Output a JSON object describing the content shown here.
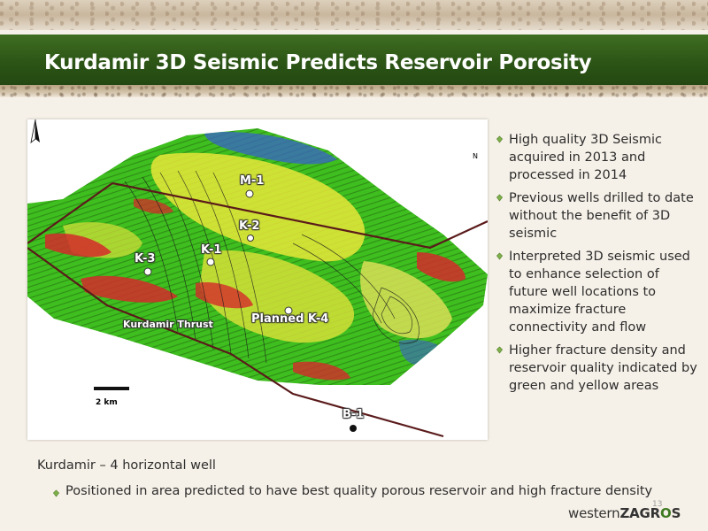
{
  "slide": {
    "title": "Kurdamir 3D Seismic Predicts Reservoir Porosity",
    "page_number": "13"
  },
  "map": {
    "north_label": "N",
    "scale_label": "2 km",
    "wells": [
      {
        "label": "M-1"
      },
      {
        "label": "K-2"
      },
      {
        "label": "K-1"
      },
      {
        "label": "K-3"
      },
      {
        "label": "Planned K-4"
      },
      {
        "label": "B-1"
      }
    ],
    "fault_label": "Kurdamir Thrust",
    "colors": {
      "green": "#3fbf1f",
      "yellow": "#e8e63a",
      "red": "#d42a2a",
      "blue": "#3a63c9"
    }
  },
  "bullets": [
    {
      "text": "High quality 3D Seismic acquired in 2013 and processed in 2014"
    },
    {
      "text": "Previous wells drilled to date without the benefit of 3D seismic"
    },
    {
      "text": "Interpreted 3D seismic used to enhance selection of future well locations to maximize fracture connectivity and flow"
    },
    {
      "text": "Higher fracture density  and reservoir quality indicated by green and yellow areas"
    }
  ],
  "bottom": {
    "heading": "Kurdamir – 4 horizontal well",
    "bullet": "Positioned  in area predicted to have best quality porous reservoir and high fracture density"
  },
  "logo": {
    "part1": "western",
    "part2a": "ZAGR",
    "part2b": "O",
    "part2c": "S"
  },
  "theme": {
    "title_bar": "#2c5516",
    "bullet_green": "#7fb04a"
  }
}
